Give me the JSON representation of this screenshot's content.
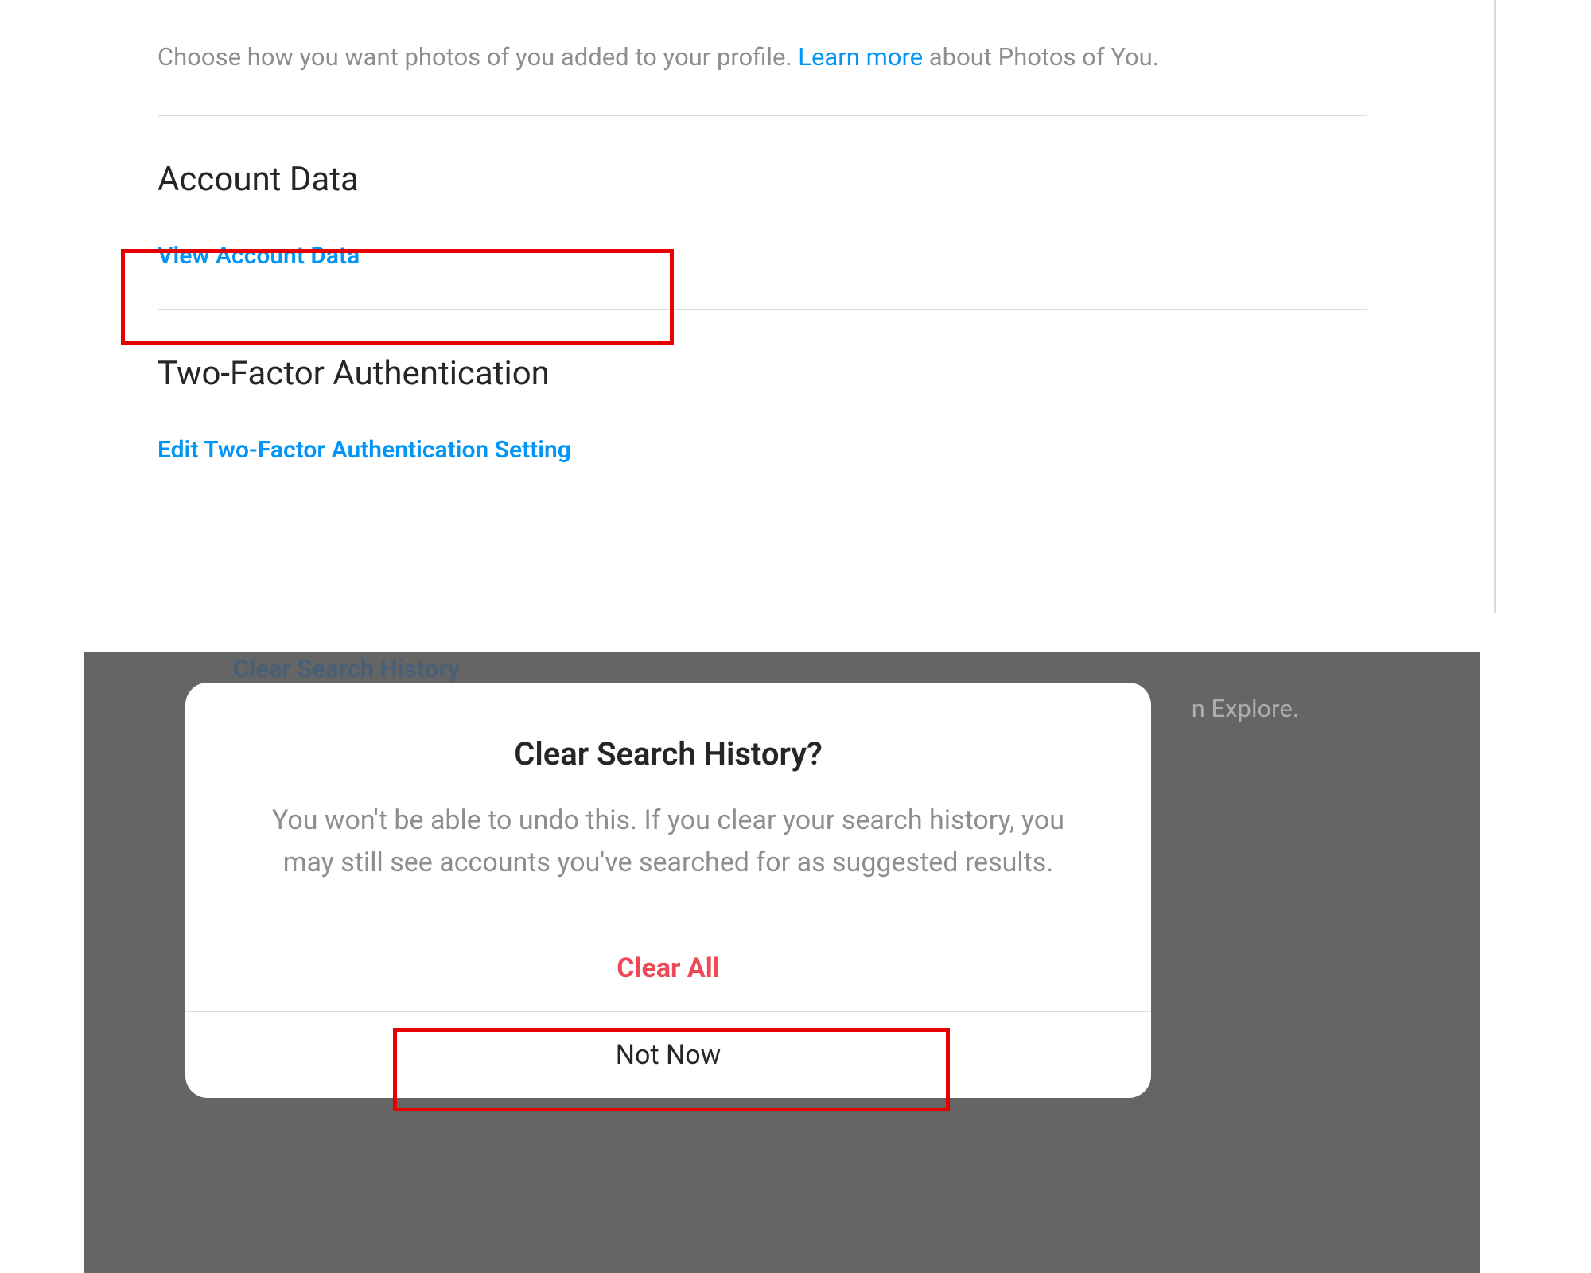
{
  "settings": {
    "photos_description_1": "Choose how you want photos of you added to your profile. ",
    "photos_learn_more": "Learn more",
    "photos_description_2": " about Photos of You.",
    "sections": {
      "account_data": {
        "title": "Account Data",
        "link": "View Account Data"
      },
      "two_factor": {
        "title": "Two-Factor Authentication",
        "link": "Edit Two-Factor Authentication Setting"
      }
    }
  },
  "background": {
    "clear_search_label": "Clear Search History",
    "explore_fragment": "n Explore."
  },
  "dialog": {
    "title": "Clear Search History?",
    "body": "You won't be able to undo this. If you clear your search history, you may still see accounts you've searched for as suggested results.",
    "clear_all": "Clear All",
    "not_now": "Not Now"
  }
}
